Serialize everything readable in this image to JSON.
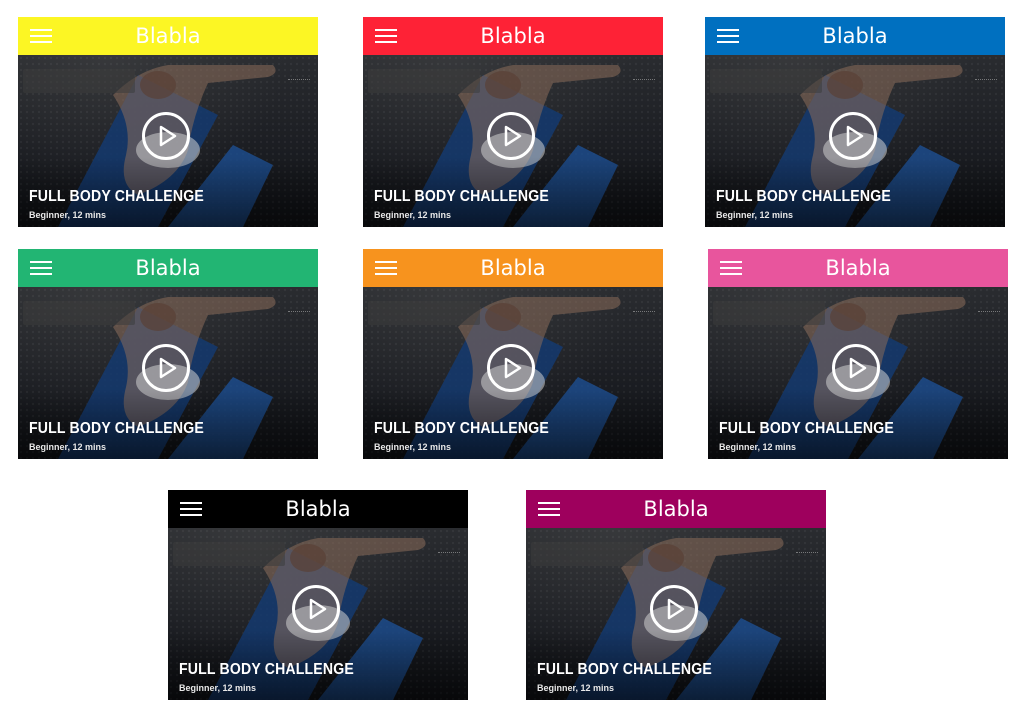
{
  "cards": [
    {
      "title": "Blabla",
      "color": "#fcf624",
      "hero_title": "FULL BODY CHALLENGE",
      "hero_subtitle": "Beginner, 12 mins"
    },
    {
      "title": "Blabla",
      "color": "#fe2236",
      "hero_title": "FULL BODY CHALLENGE",
      "hero_subtitle": "Beginner, 12 mins"
    },
    {
      "title": "Blabla",
      "color": "#0070c0",
      "hero_title": "FULL BODY CHALLENGE",
      "hero_subtitle": "Beginner, 12 mins"
    },
    {
      "title": "Blabla",
      "color": "#22b573",
      "hero_title": "FULL BODY CHALLENGE",
      "hero_subtitle": "Beginner, 12 mins"
    },
    {
      "title": "Blabla",
      "color": "#f7931e",
      "hero_title": "FULL BODY CHALLENGE",
      "hero_subtitle": "Beginner, 12 mins"
    },
    {
      "title": "Blabla",
      "color": "#e8559d",
      "hero_title": "FULL BODY CHALLENGE",
      "hero_subtitle": "Beginner, 12 mins"
    },
    {
      "title": "Blabla",
      "color": "#000000",
      "hero_title": "FULL BODY CHALLENGE",
      "hero_subtitle": "Beginner, 12 mins"
    },
    {
      "title": "Blabla",
      "color": "#9e005d",
      "hero_title": "FULL BODY CHALLENGE",
      "hero_subtitle": "Beginner, 12 mins"
    }
  ],
  "icons": {
    "menu": "hamburger-menu-icon",
    "play": "play-icon"
  }
}
